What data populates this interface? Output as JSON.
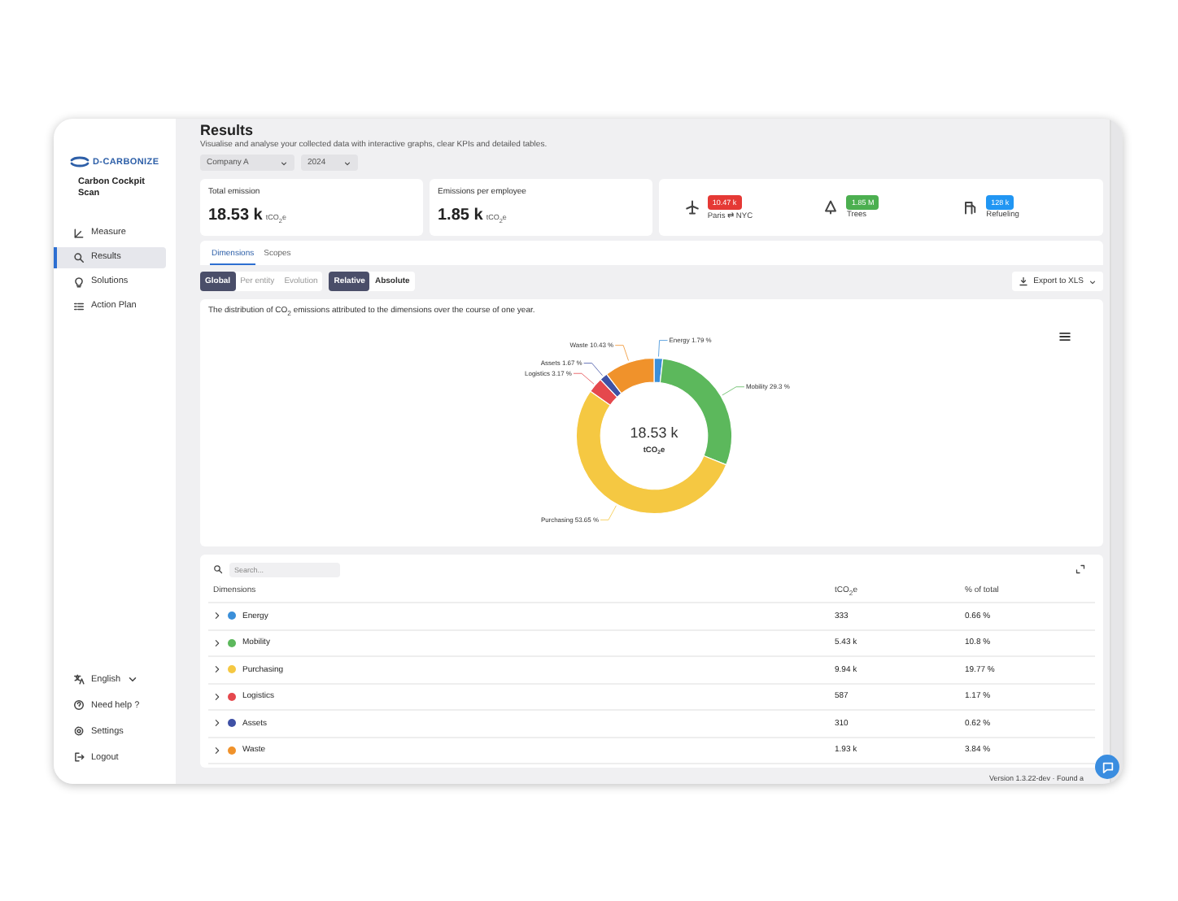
{
  "brand": {
    "name": "D-CARBONIZE"
  },
  "project": "Carbon Cockpit Scan",
  "nav": [
    {
      "label": "Measure",
      "kind": "measure",
      "selected": false
    },
    {
      "label": "Results",
      "kind": "results",
      "selected": true
    },
    {
      "label": "Solutions",
      "kind": "solutions",
      "selected": false
    },
    {
      "label": "Action Plan",
      "kind": "plan",
      "selected": false
    }
  ],
  "footer_nav": [
    {
      "label": "English",
      "kind": "language"
    },
    {
      "label": "Need help ?",
      "kind": "help"
    },
    {
      "label": "Settings",
      "kind": "settings"
    },
    {
      "label": "Logout",
      "kind": "logout"
    }
  ],
  "header": {
    "title": "Results",
    "subtitle": "Visualise and analyse your collected data with interactive graphs, clear KPIs and detailed tables.",
    "filters": [
      {
        "value": "Company A"
      },
      {
        "value": "2024"
      }
    ]
  },
  "kpis": [
    {
      "label": "Total emission",
      "value": "18.53 k",
      "unit": "tCO$_{2}$e"
    },
    {
      "label": "Emissions per employee",
      "value": "1.85 k",
      "unit": "tCO$_{2}$e"
    }
  ],
  "equivalences": [
    {
      "kind": "flight",
      "badge": "10.47 k",
      "label": "Paris ⇄ NYC",
      "color": "#e53935"
    },
    {
      "kind": "tree",
      "badge": "1.85 M",
      "label": "Trees",
      "color": "#4caf50"
    },
    {
      "kind": "fuel",
      "badge": "128 k",
      "label": "Refueling",
      "color": "#2196f3"
    }
  ],
  "tabs": [
    {
      "label": "Dimensions",
      "selected": true
    },
    {
      "label": "Scopes",
      "selected": false
    }
  ],
  "view_toggle": [
    {
      "label": "Global",
      "selected": true
    },
    {
      "label": "Per entity",
      "selected": false
    },
    {
      "label": "Evolution",
      "selected": false
    }
  ],
  "mode_toggle": [
    {
      "label": "Relative",
      "selected": true
    },
    {
      "label": "Absolute",
      "selected": false
    }
  ],
  "export_button": "Export to XLS",
  "chart": {
    "description": "The distribution of CO$_{2}$ emissions attributed to the dimensions over the course of one year.",
    "center_value": "18.53 k",
    "center_unit": "tCO$_{2}$e",
    "chart_data": {
      "type": "donut",
      "categories": [
        "Energy",
        "Mobility",
        "Purchasing",
        "Logistics",
        "Assets",
        "Waste"
      ],
      "values": [
        1.79,
        29.3,
        53.65,
        3.17,
        1.67,
        10.43
      ],
      "value_labels": [
        "1.79 %",
        "29.3 %",
        "53.65 %",
        "3.17 %",
        "1.67 %",
        "10.43 %"
      ]
    }
  },
  "table": {
    "search_placeholder": "Search...",
    "columns": [
      "Dimensions",
      "tCO$_{2}$e",
      "% of total"
    ],
    "rows": [
      {
        "name": "Energy",
        "color": "#3b8fd9",
        "value": "333",
        "share": "0.66 %",
        "expanded": false
      },
      {
        "name": "Mobility",
        "color": "#5cb85c",
        "value": "5.43 k",
        "share": "10.8 %",
        "expanded": false
      },
      {
        "name": "Purchasing",
        "color": "#f5c842",
        "value": "9.94 k",
        "share": "19.77 %",
        "expanded": false
      },
      {
        "name": "Logistics",
        "color": "#e5484d",
        "value": "587",
        "share": "1.17 %",
        "expanded": false
      },
      {
        "name": "Assets",
        "color": "#3f51a5",
        "value": "310",
        "share": "0.62 %",
        "expanded": false
      },
      {
        "name": "Waste",
        "color": "#f0922b",
        "value": "1.93 k",
        "share": "3.84 %",
        "expanded": false
      }
    ]
  },
  "footer": "Version 1.3.22-dev · Found a"
}
